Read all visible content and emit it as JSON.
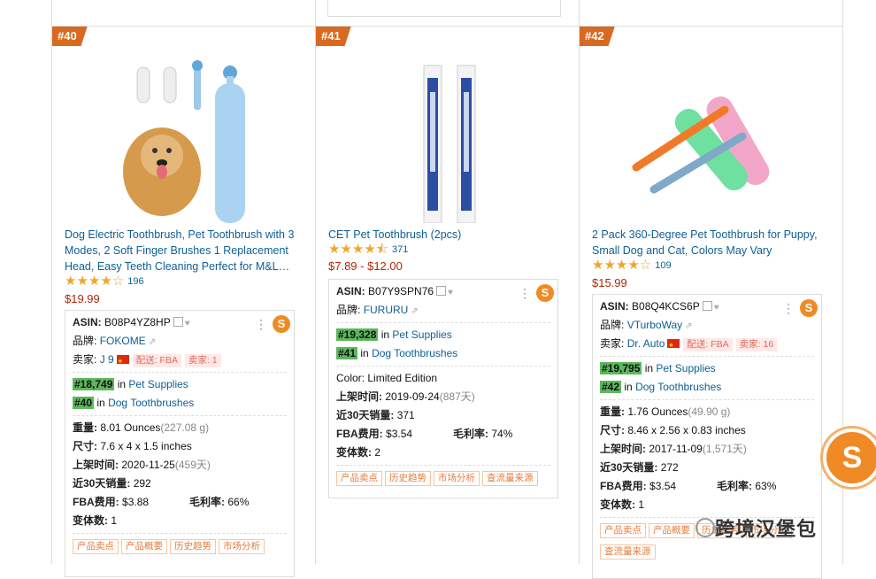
{
  "cards": [
    {
      "rank": "#40",
      "title": "Dog Electric Toothbrush, Pet Toothbrush with 3 Modes, 2 Soft Finger Brushes 1 Replacement Head, Easy Teeth Cleaning Perfect for M&L…",
      "rating": 4.0,
      "review_count": "196",
      "price": "$19.99",
      "asin_label": "ASIN:",
      "asin": "B08P4YZ8HP",
      "brand_label": "品牌:",
      "brand": "FOKOME",
      "seller_label": "卖家:",
      "seller": "J 9",
      "seller_tags": [
        "配送: FBA",
        "卖家: 1"
      ],
      "ranks": [
        {
          "rank": "#18,749",
          "in": "in",
          "category": "Pet Supplies"
        },
        {
          "rank": "#40",
          "in": "in",
          "category": "Dog Toothbrushes"
        }
      ],
      "weight_label": "重量:",
      "weight": "8.01 Ounces",
      "weight_alt": "(227.08 g)",
      "size_label": "尺寸:",
      "size": "7.6 x 4 x 1.5 inches",
      "listed_label": "上架时间:",
      "listed": "2020-11-25",
      "listed_days": "(459天)",
      "sales_label": "近30天销量:",
      "sales": "292",
      "fba_label": "FBA费用:",
      "fba": "$3.88",
      "margin_label": "毛利率:",
      "margin": "66%",
      "variants_label": "变体数:",
      "variants": "1",
      "tags": [
        "产品卖点",
        "产品概要",
        "历史趋势",
        "市场分析"
      ]
    },
    {
      "rank": "#41",
      "title": "CET Pet Toothbrush (2pcs)",
      "rating": 4.5,
      "review_count": "371",
      "price": "$7.89 - $12.00",
      "asin_label": "ASIN:",
      "asin": "B07Y9SPN76",
      "brand_label": "品牌:",
      "brand": "FURURU",
      "ranks": [
        {
          "rank": "#19,328",
          "in": "in",
          "category": "Pet Supplies"
        },
        {
          "rank": "#41",
          "in": "in",
          "category": "Dog Toothbrushes"
        }
      ],
      "color_label": "Color:",
      "color": "Limited Edition",
      "listed_label": "上架时间:",
      "listed": "2019-09-24",
      "listed_days": "(887天)",
      "sales_label": "近30天销量:",
      "sales": "371",
      "fba_label": "FBA费用:",
      "fba": "$3.54",
      "margin_label": "毛利率:",
      "margin": "74%",
      "variants_label": "变体数:",
      "variants": "2",
      "tags": [
        "产品卖点",
        "历史趋势",
        "市场分析",
        "查流量来源"
      ]
    },
    {
      "rank": "#42",
      "title": "2 Pack 360-Degree Pet Toothbrush for Puppy, Small Dog and Cat, Colors May Vary",
      "rating": 4.0,
      "review_count": "109",
      "price": "$15.99",
      "asin_label": "ASIN:",
      "asin": "B08Q4KCS6P",
      "brand_label": "品牌:",
      "brand": "VTurboWay",
      "seller_label": "卖家:",
      "seller": "Dr. Auto",
      "seller_tags": [
        "配送: FBA",
        "卖家: 16"
      ],
      "ranks": [
        {
          "rank": "#19,795",
          "in": "in",
          "category": "Pet Supplies"
        },
        {
          "rank": "#42",
          "in": "in",
          "category": "Dog Toothbrushes"
        }
      ],
      "weight_label": "重量:",
      "weight": "1.76 Ounces",
      "weight_alt": "(49.90 g)",
      "size_label": "尺寸:",
      "size": "8.46 x 2.56 x 0.83 inches",
      "listed_label": "上架时间:",
      "listed": "2017-11-09",
      "listed_days": "(1,571天)",
      "sales_label": "近30天销量:",
      "sales": "272",
      "fba_label": "FBA费用:",
      "fba": "$3.54",
      "margin_label": "毛利率:",
      "margin": "63%",
      "variants_label": "变体数:",
      "variants": "1",
      "tags": [
        "产品卖点",
        "产品概要",
        "历史趋势",
        "市场分析",
        "查流量来源"
      ]
    }
  ],
  "watermark": "跨境汉堡包",
  "logo_letter": "S",
  "colors": {
    "rank_badge": "#d9691f",
    "link": "#0d5f94",
    "price": "#b12704",
    "bsr_badge": "#5cb85c"
  }
}
